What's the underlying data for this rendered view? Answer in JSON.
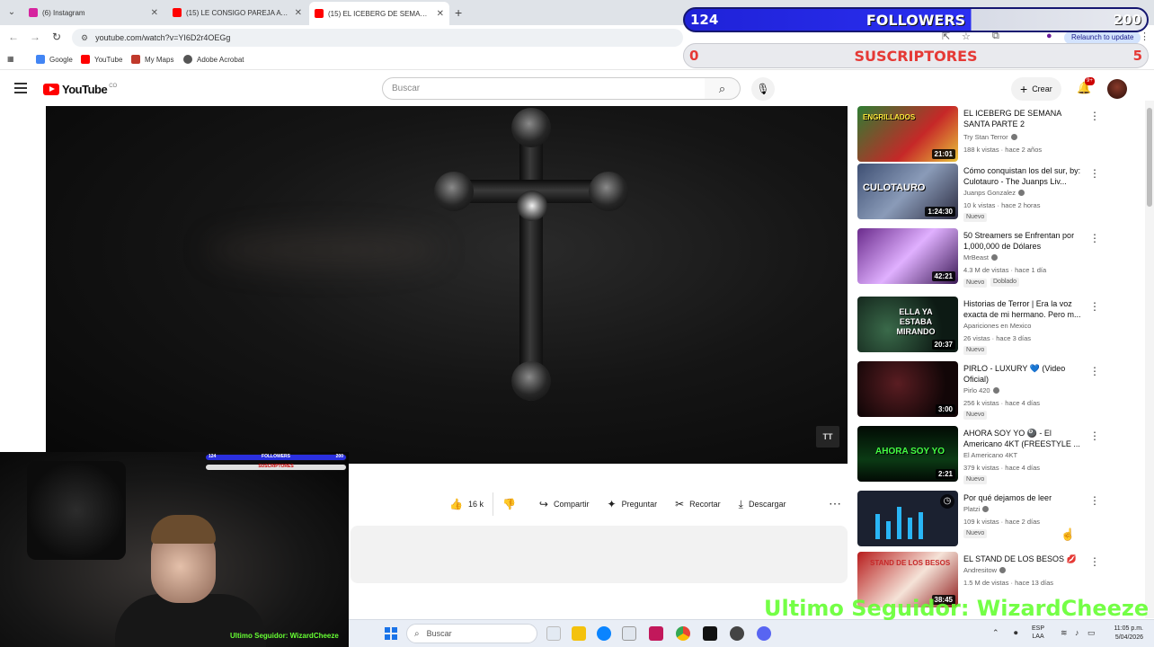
{
  "browser": {
    "tabs": [
      {
        "label": "(6) Instagram",
        "color": "#d6249f"
      },
      {
        "label": "(15) LE CONSIGO PAREJA A OVE",
        "color": "#ff0000"
      },
      {
        "label": "(15) EL ICEBERG DE SEMANA S",
        "color": "#ff0000"
      }
    ],
    "new_tab": "+",
    "url": "youtube.com/watch?v=YI6D2r4OEGg",
    "update_label": "Relaunch to update",
    "bookmarks": [
      {
        "label": "Google",
        "color": "#4285f4"
      },
      {
        "label": "YouTube",
        "color": "#ff0000"
      },
      {
        "label": "My Maps",
        "color": "#c0392b"
      },
      {
        "label": "Adobe Acrobat",
        "color": "#555555"
      }
    ]
  },
  "overlay": {
    "followers_count": "124",
    "followers_label": "FOLLOWERS",
    "followers_goal": "200",
    "followers_progress": 0.62,
    "subs_count": "0",
    "subs_label": "SUSCRIPTORES",
    "subs_goal": "5",
    "last_follower": "Ultimo Seguidor: WizardCheeze"
  },
  "youtube": {
    "logo_text": "YouTube",
    "logo_country": "CO",
    "search_placeholder": "Buscar",
    "create_label": "Crear",
    "notif_badge": "9+"
  },
  "video": {
    "overlay_icon": "TT"
  },
  "actions": {
    "likes": "16 k",
    "share": "Compartir",
    "ask": "Preguntar",
    "clip": "Recortar",
    "download": "Descargar"
  },
  "recommendations": [
    {
      "title": "EL ICEBERG DE SEMANA SANTA PARTE 2",
      "channel": "Try Stan Terror",
      "verified": true,
      "meta": "188 k vistas · hace 2 años",
      "badge": "",
      "badge2": "",
      "duration": "21:01",
      "thumb_text": "ENGRILLADOS",
      "thumb_color": "#2e7d32"
    },
    {
      "title": "Cómo conquistan los del sur, by: Culotauro - The Juanps Liv...",
      "channel": "Juanps Gonzalez",
      "verified": true,
      "meta": "10 k vistas · hace 2 horas",
      "badge": "Nuevo",
      "badge2": "",
      "duration": "1:24:30",
      "thumb_text": "CULOTAURO",
      "thumb_color": "#3e4f73"
    },
    {
      "title": "50 Streamers se Enfrentan por 1,000,000 de Dólares",
      "channel": "MrBeast",
      "verified": true,
      "meta": "4.3 M de vistas · hace 1 día",
      "badge": "Nuevo",
      "badge2": "Doblado",
      "duration": "42:21",
      "thumb_text": "",
      "thumb_color": "#6a2b8c"
    },
    {
      "title": "Historias de Terror | Era la voz exacta de mi hermano. Pero m...",
      "channel": "Apariciones en Mexico",
      "verified": false,
      "meta": "26 vistas · hace 3 días",
      "badge": "Nuevo",
      "badge2": "",
      "duration": "20:37",
      "thumb_text": "ELLA YA ESTABA MIRANDO",
      "thumb_color": "#1f3a2f"
    },
    {
      "title": "PIRLO - LUXURY 💙 (Video Oficial)",
      "channel": "Pirlo 420",
      "verified": true,
      "meta": "256 k vistas · hace 4 días",
      "badge": "Nuevo",
      "badge2": "",
      "duration": "3:00",
      "thumb_text": "",
      "thumb_color": "#3a0f12"
    },
    {
      "title": "AHORA SOY YO 🎱 - El Americano 4KT (FREESTYLE ...",
      "channel": "El Americano 4KT",
      "verified": false,
      "meta": "379 k vistas · hace 4 días",
      "badge": "Nuevo",
      "badge2": "",
      "duration": "2:21",
      "thumb_text": "AHORA SOY YO",
      "thumb_color": "#0a3a12"
    },
    {
      "title": "Por qué dejamos de leer",
      "channel": "Platzi",
      "verified": true,
      "meta": "109 k vistas · hace 2 días",
      "badge": "Nuevo",
      "badge2": "",
      "duration": "",
      "thumb_text": "",
      "thumb_color": "#1b2130"
    },
    {
      "title": "EL STAND DE LOS BESOS 💋",
      "channel": "Andresitow",
      "verified": true,
      "meta": "1.5 M de vistas · hace 13 días",
      "badge": "",
      "badge2": "",
      "duration": "38:45",
      "thumb_text": "STAND DE LOS BESOS",
      "thumb_color": "#b71c1c"
    }
  ],
  "taskbar": {
    "search_placeholder": "Buscar",
    "lang_top": "ESP",
    "lang_bottom": "LAA",
    "time": "11:05 p.m.",
    "date": "5/04/2026"
  }
}
